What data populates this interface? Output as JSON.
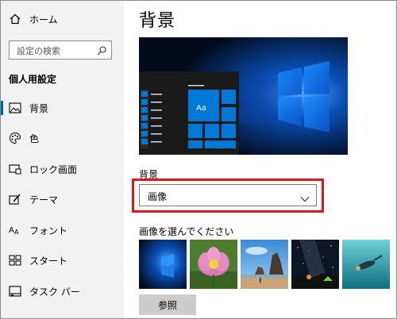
{
  "sidebar": {
    "home_label": "ホーム",
    "search_placeholder": "設定の検索",
    "section_title": "個人用設定",
    "items": [
      {
        "label": "背景",
        "icon": "picture-icon",
        "selected": true
      },
      {
        "label": "色",
        "icon": "palette-icon",
        "selected": false
      },
      {
        "label": "ロック画面",
        "icon": "lock-screen-icon",
        "selected": false
      },
      {
        "label": "テーマ",
        "icon": "theme-brush-icon",
        "selected": false
      },
      {
        "label": "フォント",
        "icon": "font-icon",
        "selected": false
      },
      {
        "label": "スタート",
        "icon": "start-tiles-icon",
        "selected": false
      },
      {
        "label": "タスク バー",
        "icon": "taskbar-icon",
        "selected": false
      }
    ]
  },
  "main": {
    "title": "背景",
    "preview_tile_text": "Aa",
    "background_label": "背景",
    "background_value": "画像",
    "choose_picture_label": "画像を選んでください",
    "browse_label": "参照"
  },
  "colors": {
    "accent": "#0063b1",
    "highlight_border": "#e0161c",
    "sidebar_bg": "#f2f2f2"
  }
}
